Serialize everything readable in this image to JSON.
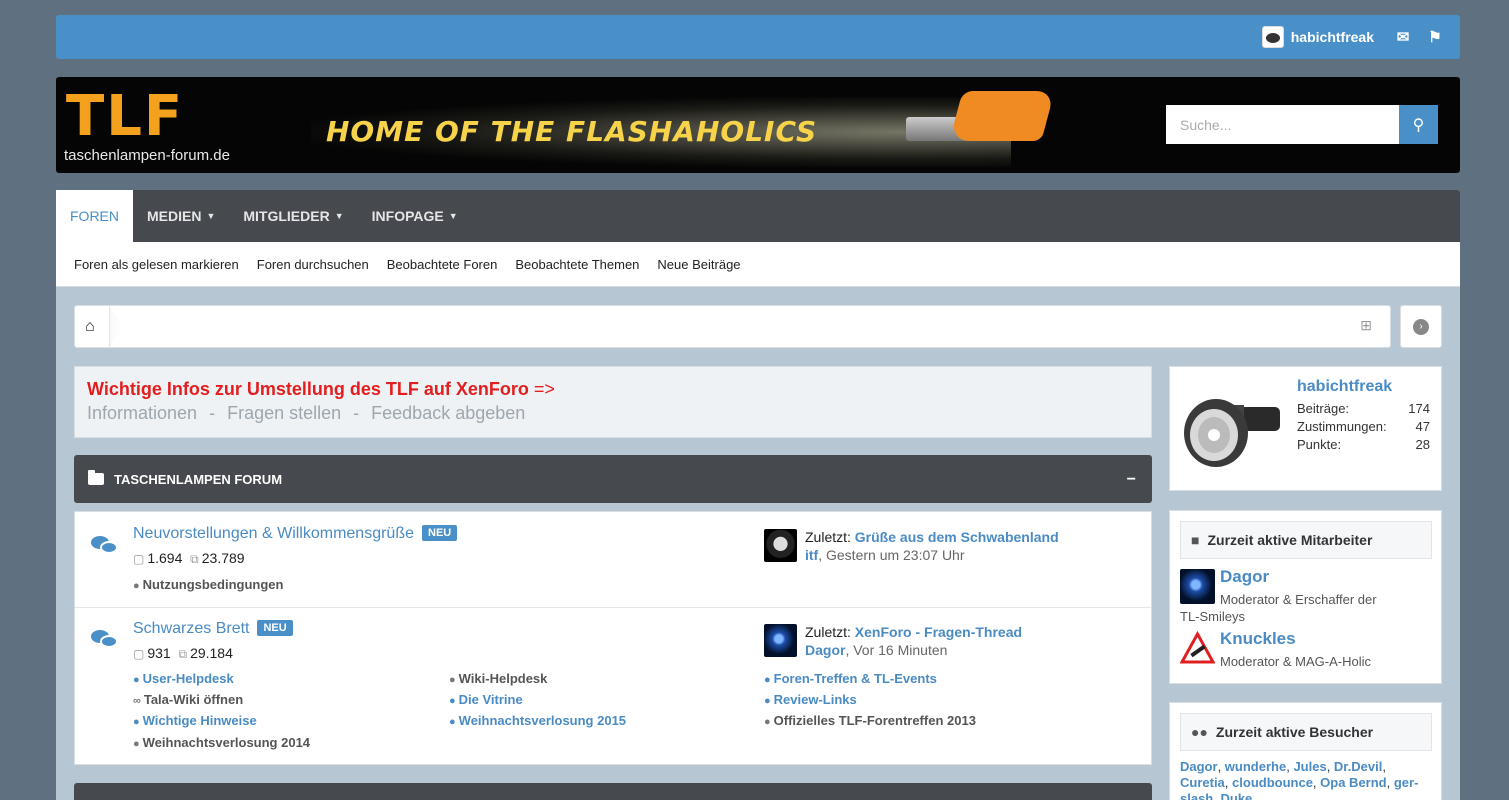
{
  "topbar": {
    "username": "habichtfreak",
    "mail_icon": "envelope-icon",
    "alerts_icon": "flag-icon"
  },
  "banner": {
    "logo_text": "TLF",
    "logo_subtitle": "taschenlampen-forum.de",
    "slogan": "HOME OF THE FLASHAHOLICS"
  },
  "search": {
    "placeholder": "Suche..."
  },
  "nav": {
    "tabs": [
      {
        "label": "Foren",
        "active": true
      },
      {
        "label": "Medien",
        "dropdown": true
      },
      {
        "label": "Mitglieder",
        "dropdown": true
      },
      {
        "label": "Infopage",
        "dropdown": true
      }
    ],
    "subnav": [
      "Foren als gelesen markieren",
      "Foren durchsuchen",
      "Beobachtete Foren",
      "Beobachtete Themen",
      "Neue Beiträge"
    ]
  },
  "notice": {
    "headline": "Wichtige Infos zur Umstellung des TLF auf XenForo",
    "arrow": "=>",
    "links": [
      "Informationen",
      "Fragen stellen",
      "Feedback abgeben"
    ],
    "separator": "-"
  },
  "category": {
    "title": "TASCHENLAMPEN FORUM",
    "collapse": "−"
  },
  "forums": [
    {
      "title": "Neuvorstellungen & Willkommensgrüße",
      "badge": "NEU",
      "threads": "1.694",
      "posts": "23.789",
      "subforums": [
        "Nutzungsbedingungen"
      ],
      "last_prefix": "Zuletzt:",
      "last_thread": "Grüße aus dem Schwabenland",
      "last_user": "itf",
      "last_time": ", Gestern um 23:07 Uhr"
    },
    {
      "title": "Schwarzes Brett",
      "badge": "NEU",
      "threads": "931",
      "posts": "29.184",
      "subforums": [
        "User-Helpdesk",
        "Wiki-Helpdesk",
        "Foren-Treffen & TL-Events",
        "Tala-Wiki öffnen",
        "Die Vitrine",
        "Review-Links",
        "Wichtige Hinweise",
        "Weihnachtsverlosung 2015",
        "Offizielles TLF-Forentreffen 2013",
        "Weihnachtsverlosung 2014"
      ],
      "last_prefix": "Zuletzt:",
      "last_thread": "XenForo - Fragen-Thread",
      "last_user": "Dagor",
      "last_time": ", Vor 16 Minuten"
    }
  ],
  "sidebar": {
    "user": {
      "name": "habichtfreak",
      "stats": [
        {
          "label": "Beiträge:",
          "value": "174"
        },
        {
          "label": "Zustimmungen:",
          "value": "47"
        },
        {
          "label": "Punkte:",
          "value": "28"
        }
      ]
    },
    "staff": {
      "title": "Zurzeit aktive Mitarbeiter",
      "members": [
        {
          "name": "Dagor",
          "role": "Moderator & Erschaffer der",
          "role2": "TL-Smileys"
        },
        {
          "name": "Knuckles",
          "role": "Moderator & MAG-A-Holic"
        }
      ]
    },
    "visitors": {
      "title": "Zurzeit aktive Besucher",
      "names": [
        "Dagor",
        "wunderhe",
        "Jules",
        "Dr.Devil",
        "Curetia",
        "cloudbounce",
        "Opa Bernd",
        "ger-slash",
        "Duke"
      ]
    }
  },
  "colors": {
    "accent": "#4a90c8",
    "nav_dark": "#46494d",
    "notice_red": "#e31e1e",
    "page_bg": "#5f7180"
  }
}
